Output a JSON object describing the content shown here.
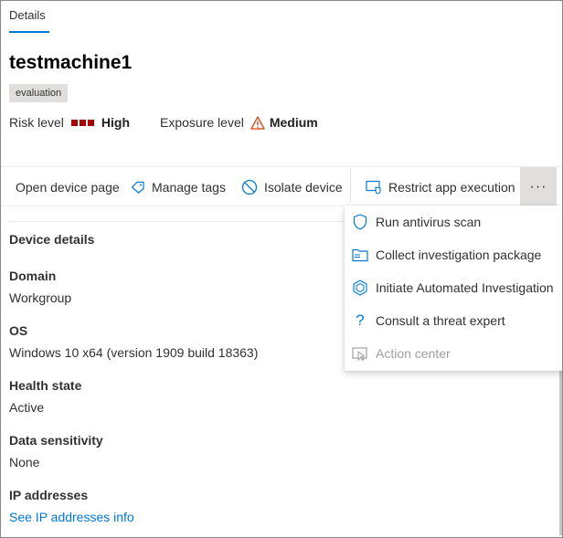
{
  "tabs": {
    "active": "Details"
  },
  "device": {
    "name": "testmachine1",
    "tag": "evaluation",
    "risk_label": "Risk level",
    "risk_value": "High",
    "exposure_label": "Exposure level",
    "exposure_value": "Medium"
  },
  "toolbar": {
    "open_device_page": "Open device page",
    "manage_tags": "Manage tags",
    "isolate_device": "Isolate device",
    "restrict_app_execution": "Restrict app execution",
    "more": "···"
  },
  "menu": {
    "items": [
      {
        "label": "Run antivirus scan",
        "icon": "shield-icon",
        "enabled": true
      },
      {
        "label": "Collect investigation package",
        "icon": "package-icon",
        "enabled": true
      },
      {
        "label": "Initiate Automated Investigation",
        "icon": "investigation-icon",
        "enabled": true
      },
      {
        "label": "Consult a threat expert",
        "icon": "question-icon",
        "enabled": true
      },
      {
        "label": "Action center",
        "icon": "action-center-icon",
        "enabled": false
      }
    ]
  },
  "details": {
    "section_title": "Device details",
    "domain_label": "Domain",
    "domain_value": "Workgroup",
    "os_label": "OS",
    "os_value": "Windows 10 x64 (version 1909 build 18363)",
    "health_label": "Health state",
    "health_value": "Active",
    "sensitivity_label": "Data sensitivity",
    "sensitivity_value": "None",
    "ip_label": "IP addresses",
    "ip_link": "See IP addresses info"
  },
  "colors": {
    "accent": "#0078d4",
    "risk_high": "#a80000",
    "warning": "#d83b01",
    "disabled_text": "#a19f9d"
  }
}
